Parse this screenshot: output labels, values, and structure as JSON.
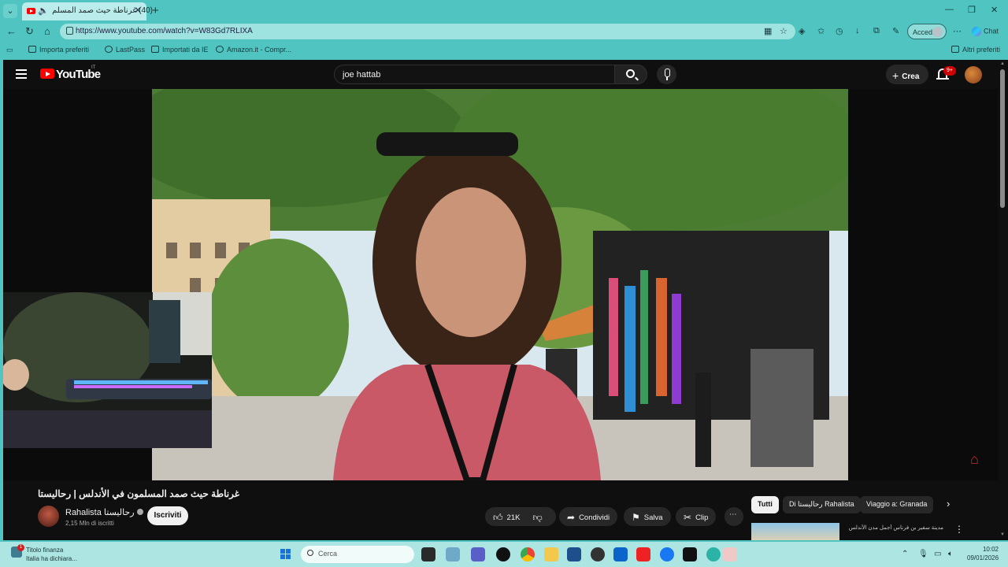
{
  "browser": {
    "tab_title": "(40) غرناطة حيث صمد المسلم",
    "url": "https://www.youtube.com/watch?v=W83Gd7RLIXA",
    "accedi_label": "Accedi",
    "chat_label": "Chat",
    "bookmarks": [
      "Importa preferiti",
      "LastPass",
      "Importati da IE",
      "Amazon.it - Compr...",
      "Altri preferiti"
    ]
  },
  "youtube": {
    "logo_text": "YouTube",
    "region_code": "IT",
    "search_query": "joe hattab",
    "create_label": "Crea",
    "notifications_badge": "9+"
  },
  "video": {
    "title": "غرناطة حيث صمد المسلمون في الأندلس | رحاليستا",
    "channel_name": "Rahalista رحاليستا",
    "subscribers": "2,15 Mln di iscritti",
    "subscribe_label": "Iscriviti",
    "likes": "21K",
    "share_label": "Condividi",
    "save_label": "Salva",
    "clip_label": "Clip"
  },
  "recommendations": {
    "chips": [
      "Tutti",
      "Di رحاليستا Rahalista",
      "Viaggio a: Granada"
    ],
    "first_title": "مدينة سفير بن فرناس أجمل مدن الأندلس"
  },
  "taskbar": {
    "widget_badge": "1",
    "widget_title": "Titolo finanza",
    "widget_subtitle": "Italia ha dichiara...",
    "search_placeholder": "Cerca",
    "time": "10:02",
    "date": "09/01/2026"
  }
}
